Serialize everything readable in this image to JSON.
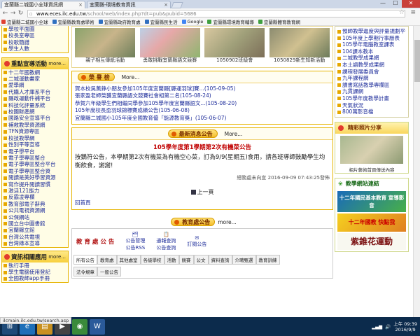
{
  "browser": {
    "tabs": [
      {
        "label": "宜蘭縣二城國小全球資訊網",
        "active": true
      },
      {
        "label": "宜蘭縣-環境教育資訊",
        "active": false
      }
    ],
    "url_host": "www.eces.ilc.edu.tw",
    "url_path": "/school/web/index.php?dt=pub&pubid=5686",
    "bookmarks": [
      {
        "label": "宜蘭縣二城國小全球",
        "color": "#e04030"
      },
      {
        "label": "宜蘭縣教育處學術",
        "color": "#3070c0"
      },
      {
        "label": "宜蘭縣政府教育處",
        "color": "#3070c0"
      },
      {
        "label": "宜蘭縣民生活",
        "color": "#3070c0"
      },
      {
        "label": "Google",
        "color": "#4285f4"
      },
      {
        "label": "宜蘭縣環境教育輔導",
        "color": "#40a040"
      },
      {
        "label": "宜蘭縣體育教育網",
        "color": "#40a040"
      }
    ],
    "status_url": "ilcmain.ilc.edu.tw/search.asp"
  },
  "left": {
    "top_items": [
      "學校平面圖",
      "校長室專區",
      "校歌簡譜",
      "學生人數"
    ],
    "activity_title": "重點宣導活動",
    "more": "more...",
    "activity_items": [
      "十二年國教網",
      "二城運動畫家",
      "愛學網",
      "代購人才庫系平台",
      "縣政運動件補平台",
      "科技化評量系統",
      "校園財產網",
      "國路安全宣導平台",
      "補救教學資源網",
      "TFN資源專區",
      "校技教學網",
      "性別平等宣導",
      "電子學平台",
      "電子學專區整合",
      "電子學專區整合平台",
      "電子學專區整合資",
      "閱讀是美好學習資源",
      "寫作提升閱讀習慣",
      "激活121能力",
      "反霸凌專欄",
      "教育部電子辭典",
      "公共電視資源網",
      "公保網站",
      "國立台中圖書館",
      "宜蘭縣立館",
      "台灣公共電視",
      "台灣綠本宣導"
    ],
    "info_title": "資訊相關應用",
    "info_items": [
      "執行手冊",
      "學生電腦使用登記",
      "全國教師app手冊"
    ]
  },
  "photos": [
    {
      "caption": "親子相互傳紙活動"
    },
    {
      "caption": "勇敢挑戰宜蘭縣語文競賽"
    },
    {
      "caption": "1050902班級會"
    },
    {
      "caption": "1050829新生知新活動"
    }
  ],
  "honor": {
    "title": "榮 譽 榜",
    "more": "More...",
    "items": [
      "賀本校吳薰錚小朋友參加105年度宜蘭縣[縣運羽球]賽...(105-09-05)",
      "張家盈老師榮獲宜蘭縣語文競賽社會組第二名(105-08-24)",
      "恭賀六年級學生們相繼同學參加105學年度宜蘭縣語文...(105-08-20)",
      "105年度校長盃羽球錦標賽成績公告(105-06-08)",
      "宜蘭縣二城國小105年度全國教育優「能源教育獎」(105-06-07)"
    ]
  },
  "latest": {
    "title": "最新消息公告",
    "more": "More...",
    "headline": "105學年度第1學期第2次有機菜公告",
    "body": "按鵝符公告，本學期第2次有機菜為有機空心菜，訂為9/9(星期五)食用，請各班導師鼓勵學生均衡飲食，謝謝!",
    "meta": "總務處未向宣  2016-09-09 07:43:25發佈",
    "prev_page": "上一頁",
    "back_home": "回首頁"
  },
  "announce": {
    "title": "教育處公告",
    "more": "more...",
    "office_label": "教 育 處 公 告",
    "icons": [
      "公告管理",
      "公告RSS",
      "通報查詢",
      "公告查詢",
      "訂閱公告"
    ],
    "tabs": [
      "所有公告",
      "教育處",
      "其他處室",
      "各級學校",
      "活動",
      "競賽",
      "公文",
      "資料查詢",
      "介聘甄選",
      "教育訓練",
      "法令規章",
      "一般公告"
    ]
  },
  "right": {
    "top_items": [
      "預師教學進度與評量規劃平台",
      "105年度上學期行事曆表",
      "105學年電腦教室課表",
      "104課本教本",
      "二城教學成果網",
      "本土語教學成果網",
      "課程發展委員會",
      "九年課程網",
      "讀書寫話教學專欄區",
      "九貫課網",
      "105學年度教學計畫",
      "天氣狀況",
      "800萬影音檔"
    ],
    "photo_title": "精彩照片分享",
    "photo_caption": "相片藝術首頁傳送內容",
    "links_title": "教學網站連結",
    "banner1": "十二年國民基本教育 宣導影音",
    "banner2": "十二年國教 快點我",
    "banner3": "紫錐花運動"
  },
  "taskbar": {
    "time": "上午 09:39",
    "date": "2016/9/9"
  },
  "colors": {
    "accent": "#e6b400",
    "link": "#1d2c9a",
    "headline": "#c00000"
  }
}
